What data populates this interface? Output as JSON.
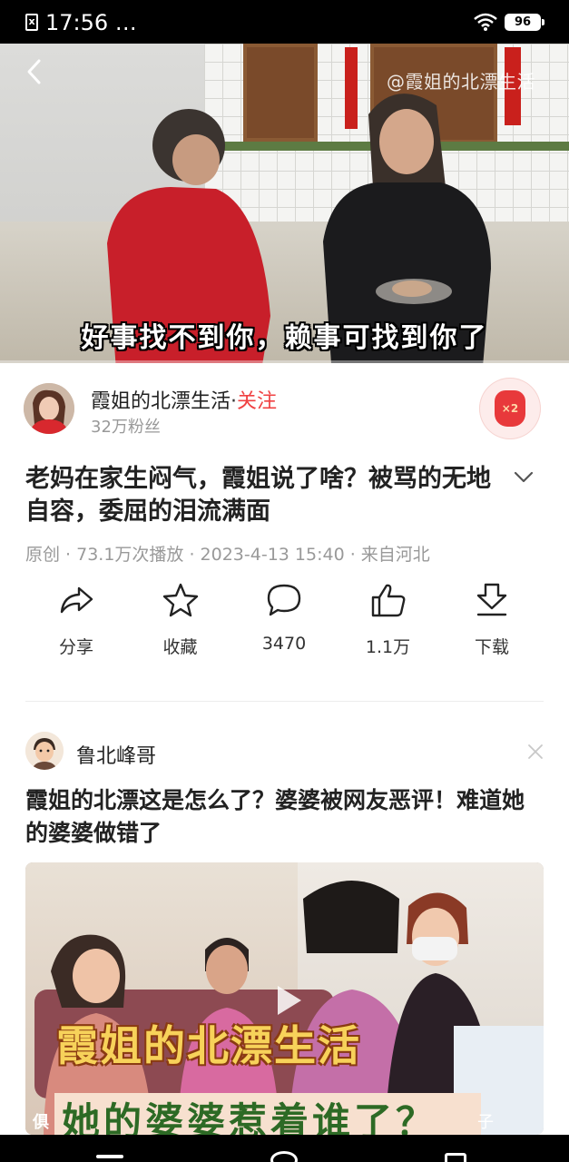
{
  "status_bar": {
    "time": "17:56 …",
    "battery": "96",
    "icons": [
      "sim-card-icon",
      "wifi-icon",
      "battery-icon"
    ]
  },
  "video": {
    "watermark": "@霞姐的北漂生活",
    "subtitle": "好事找不到你，赖事可找到你了",
    "progress_fraction": 0.0,
    "icons": [
      "back-arrow-icon"
    ]
  },
  "author": {
    "name": "霞姐的北漂生活",
    "separator": "·",
    "follow_label": "关注",
    "fans": "32万粉丝",
    "coin_badge": "×2"
  },
  "title": "老妈在家生闷气，霞姐说了啥？被骂的无地自容，委屈的泪流满面",
  "meta": "原创 · 73.1万次播放 · 2023-4-13 15:40 · 来自河北",
  "actions": [
    {
      "label": "分享",
      "icon": "share-icon"
    },
    {
      "label": "收藏",
      "icon": "star-icon"
    },
    {
      "label": "3470",
      "icon": "comment-icon"
    },
    {
      "label": "1.1万",
      "icon": "thumbs-up-icon"
    },
    {
      "label": "下载",
      "icon": "download-icon"
    }
  ],
  "feed": {
    "author": "鲁北峰哥",
    "title": "霞姐的北漂这是怎么了？婆婆被网友恶评！难道她的婆婆做错了",
    "thumb_overlay_1": "霞姐的北漂生活",
    "thumb_overlay_2": "她的婆婆惹着谁了？",
    "thumb_corner_left": "俱",
    "thumb_corner_right": "子",
    "icons": [
      "close-icon",
      "play-icon"
    ]
  },
  "nav_bar": {
    "icons": [
      "nav-back-icon",
      "nav-home-icon",
      "nav-recents-icon"
    ]
  },
  "colors": {
    "accent": "#f04142",
    "meta_gray": "#999999",
    "text": "#222222"
  }
}
